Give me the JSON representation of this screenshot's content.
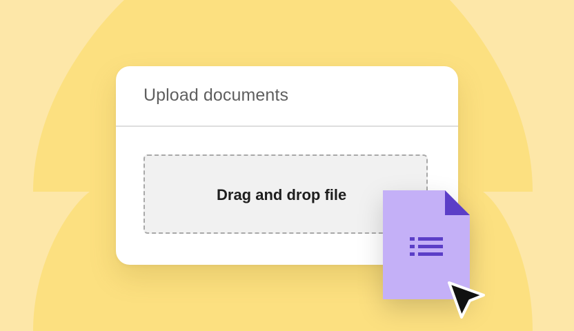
{
  "colors": {
    "background_light": "#fde7a8",
    "background_blob": "#fce080",
    "card": "#ffffff",
    "dropzone_fill": "#f1f1f1",
    "file_body": "#c4b0f7",
    "file_accent": "#5b3ec7",
    "cursor": "#111111"
  },
  "upload_card": {
    "title": "Upload documents",
    "dropzone_label": "Drag and drop file"
  },
  "dragged_file": {
    "icon": "document-list-icon"
  },
  "pointer": {
    "icon": "arrow-cursor-icon"
  }
}
